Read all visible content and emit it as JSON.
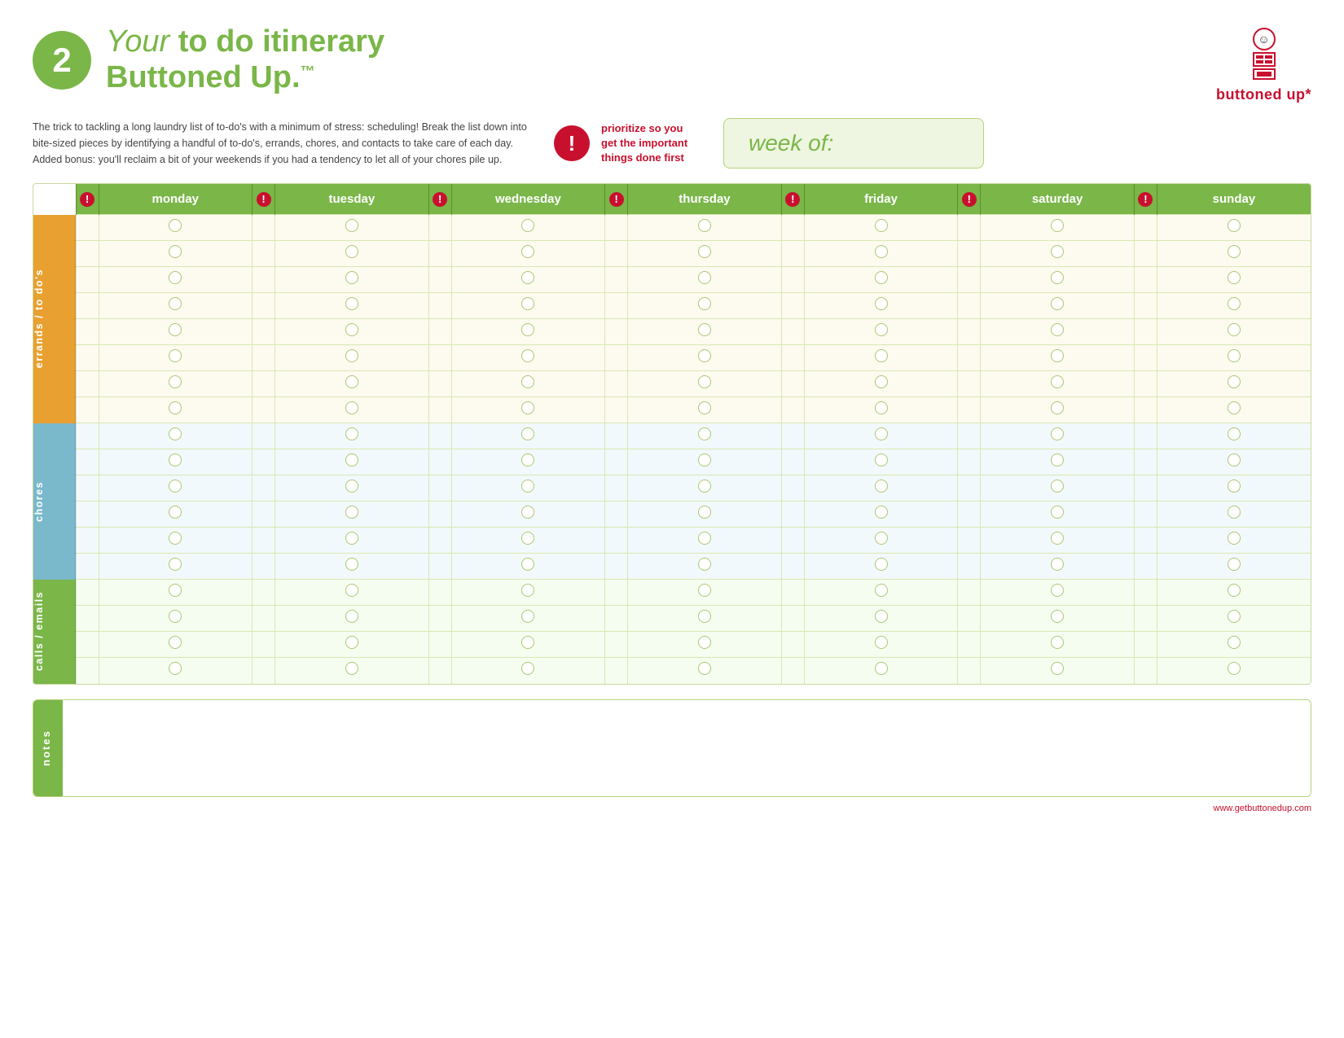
{
  "header": {
    "number": "2",
    "title_line1_italic": "Your ",
    "title_line1_bold": "to do itinerary",
    "title_line2": "Buttoned Up.",
    "title_line2_tm": "™"
  },
  "logo": {
    "text": "buttoned up*"
  },
  "intro": {
    "body": "The trick to tackling a long laundry list of to-do's with a minimum of stress: scheduling! Break the list down into bite-sized pieces by identifying a handful of to-do's, errands, chores, and contacts to take care of each day. Added bonus: you'll reclaim a bit of your weekends if you had a tendency to let all of your chores pile up."
  },
  "priority": {
    "text": "prioritize so you get the important things done first"
  },
  "week_of": {
    "label": "week of:"
  },
  "days": [
    "monday",
    "tuesday",
    "wednesday",
    "thursday",
    "friday",
    "saturday",
    "sunday"
  ],
  "sections": [
    {
      "id": "errands",
      "label": "errands / to do's",
      "rows": 8,
      "color": "#e8a030"
    },
    {
      "id": "chores",
      "label": "chores",
      "rows": 6,
      "color": "#7ab8cc"
    },
    {
      "id": "calls",
      "label": "calls / emails",
      "rows": 4,
      "color": "#7ab648"
    }
  ],
  "notes": {
    "label": "notes"
  },
  "footer": {
    "url": "www.getbuttonedup.com"
  }
}
